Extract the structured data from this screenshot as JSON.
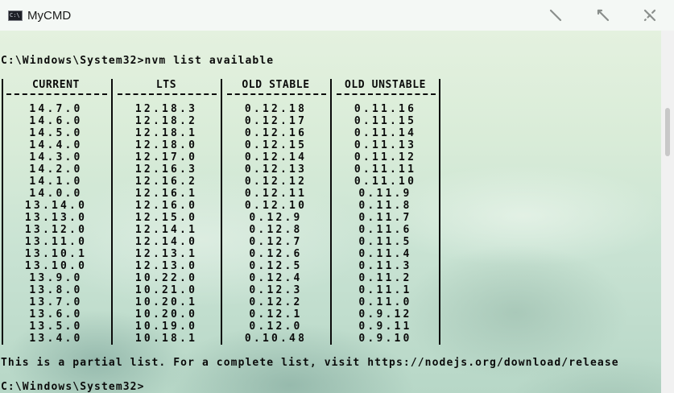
{
  "window": {
    "title": "MyCMD",
    "icon_text": "C:\\"
  },
  "console": {
    "command_line": "C:\\Windows\\System32>nvm list available",
    "table": {
      "headers": [
        "CURRENT",
        "LTS",
        "OLD STABLE",
        "OLD UNSTABLE"
      ],
      "rows": [
        [
          "14.7.0",
          "12.18.3",
          "0.12.18",
          "0.11.16"
        ],
        [
          "14.6.0",
          "12.18.2",
          "0.12.17",
          "0.11.15"
        ],
        [
          "14.5.0",
          "12.18.1",
          "0.12.16",
          "0.11.14"
        ],
        [
          "14.4.0",
          "12.18.0",
          "0.12.15",
          "0.11.13"
        ],
        [
          "14.3.0",
          "12.17.0",
          "0.12.14",
          "0.11.12"
        ],
        [
          "14.2.0",
          "12.16.3",
          "0.12.13",
          "0.11.11"
        ],
        [
          "14.1.0",
          "12.16.2",
          "0.12.12",
          "0.11.10"
        ],
        [
          "14.0.0",
          "12.16.1",
          "0.12.11",
          "0.11.9"
        ],
        [
          "13.14.0",
          "12.16.0",
          "0.12.10",
          "0.11.8"
        ],
        [
          "13.13.0",
          "12.15.0",
          "0.12.9",
          "0.11.7"
        ],
        [
          "13.12.0",
          "12.14.1",
          "0.12.8",
          "0.11.6"
        ],
        [
          "13.11.0",
          "12.14.0",
          "0.12.7",
          "0.11.5"
        ],
        [
          "13.10.1",
          "12.13.1",
          "0.12.6",
          "0.11.4"
        ],
        [
          "13.10.0",
          "12.13.0",
          "0.12.5",
          "0.11.3"
        ],
        [
          "13.9.0",
          "10.22.0",
          "0.12.4",
          "0.11.2"
        ],
        [
          "13.8.0",
          "10.21.0",
          "0.12.3",
          "0.11.1"
        ],
        [
          "13.7.0",
          "10.20.1",
          "0.12.2",
          "0.11.0"
        ],
        [
          "13.6.0",
          "10.20.0",
          "0.12.1",
          "0.9.12"
        ],
        [
          "13.5.0",
          "10.19.0",
          "0.12.0",
          "0.9.11"
        ],
        [
          "13.4.0",
          "10.18.1",
          "0.10.48",
          "0.9.10"
        ]
      ]
    },
    "partial_notice": "This is a partial list. For a complete list, visit https://nodejs.org/download/release",
    "prompt": "C:\\Windows\\System32>"
  },
  "colors": {
    "text": "#0b0b0b",
    "titlebar": "#f4f8f5",
    "scrollbar_track": "#f1f1f1",
    "scrollbar_thumb": "#c8c8c8"
  },
  "icons": {
    "minimize": "minimize-icon",
    "maximize": "maximize-icon",
    "close": "close-icon"
  }
}
